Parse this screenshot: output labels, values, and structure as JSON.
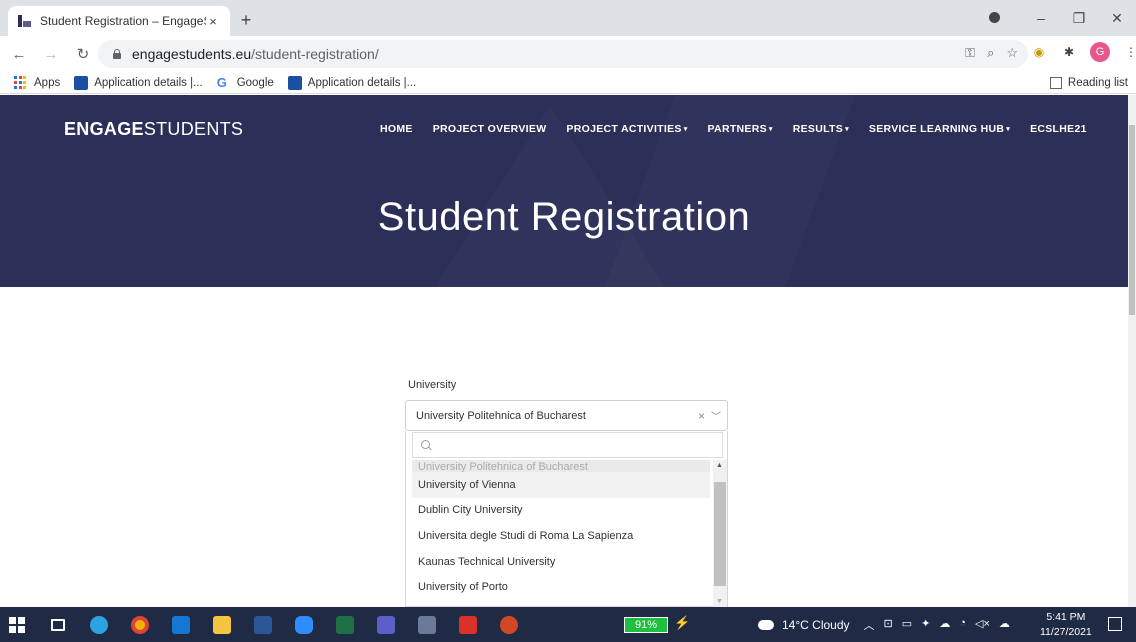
{
  "browser": {
    "tab_title": "Student Registration – EngageSt",
    "tab_close": "×",
    "new_tab": "+",
    "url_domain": "engagestudents.eu",
    "url_path": "/student-registration/",
    "window_controls": [
      "–",
      "❐",
      "✕"
    ],
    "avatar_letter": "G",
    "bookmarks": {
      "apps": "Apps",
      "items": [
        "Application details |...",
        "Google",
        "Application details |..."
      ],
      "reading_list": "Reading list"
    }
  },
  "site": {
    "logo_bold": "ENGAGE",
    "logo_light": "STUDENTS",
    "nav": [
      {
        "label": "HOME",
        "caret": ""
      },
      {
        "label": "PROJECT OVERVIEW",
        "caret": ""
      },
      {
        "label": "PROJECT ACTIVITIES",
        "caret": "▾"
      },
      {
        "label": "PARTNERS",
        "caret": "▾"
      },
      {
        "label": "RESULTS",
        "caret": "▾"
      },
      {
        "label": "SERVICE LEARNING HUB",
        "caret": "▾"
      },
      {
        "label": "ECSLHE21",
        "caret": ""
      }
    ],
    "page_title": "Student Registration"
  },
  "form": {
    "field_label": "University",
    "selected_value": "University Politehnica of Bucharest",
    "clear_icon": "×",
    "search_placeholder": "",
    "options": [
      "University Politehnica of Bucharest",
      "University of Vienna",
      "Dublin City University",
      "Universita degle Studi di Roma La Sapienza",
      "Kaunas Technical University",
      "University of Porto"
    ]
  },
  "taskbar": {
    "battery": "91%",
    "weather": "14°C  Cloudy",
    "time": "5:41 PM",
    "date": "11/27/2021"
  },
  "colors": {
    "hero_bg": "#2c2f58",
    "taskbar_bg": "#1f2a44",
    "battery_green": "#1fbf3f"
  }
}
